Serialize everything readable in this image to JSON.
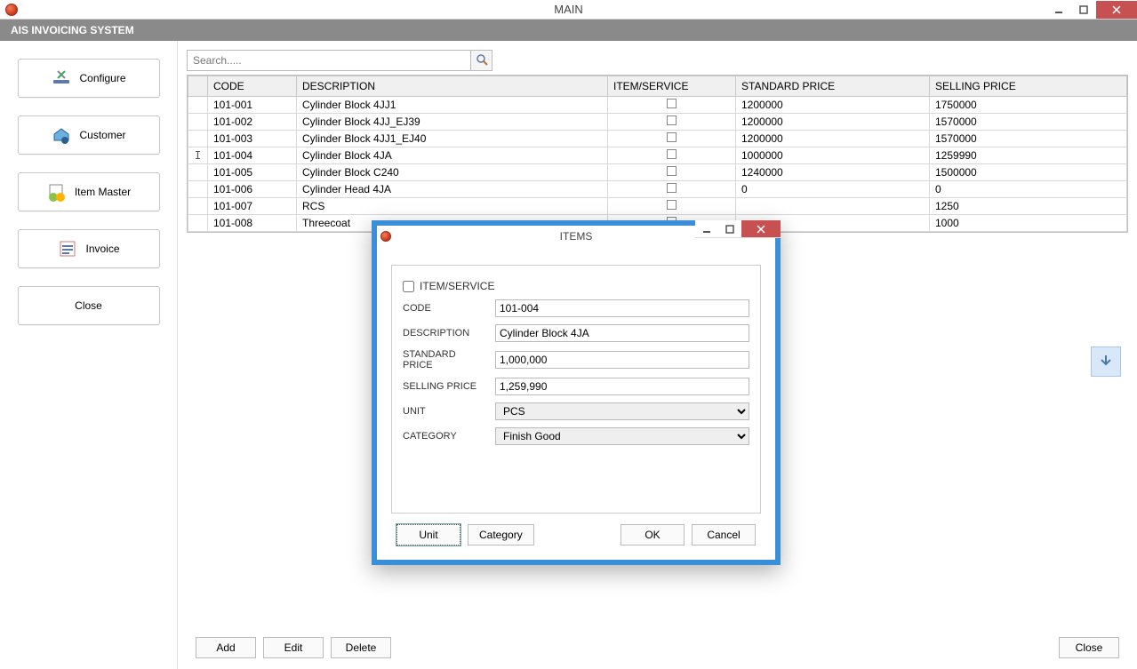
{
  "window": {
    "title": "MAIN"
  },
  "ribbon": {
    "title": "AIS INVOICING SYSTEM"
  },
  "sidebar": {
    "configure": "Configure",
    "customer": "Customer",
    "item_master": "Item Master",
    "invoice": "Invoice",
    "close": "Close"
  },
  "search": {
    "placeholder": "Search....."
  },
  "table": {
    "headers": {
      "code": "CODE",
      "description": "DESCRIPTION",
      "item_service": "ITEM/SERVICE",
      "standard_price": "STANDARD PRICE",
      "selling_price": "SELLING PRICE"
    },
    "rows": [
      {
        "indicator": "",
        "code": "101-001",
        "description": "Cylinder Block 4JJ1",
        "standard_price": "1200000",
        "selling_price": "1750000"
      },
      {
        "indicator": "",
        "code": "101-002",
        "description": "Cylinder Block 4JJ_EJ39",
        "standard_price": "1200000",
        "selling_price": "1570000"
      },
      {
        "indicator": "",
        "code": "101-003",
        "description": "Cylinder Block 4JJ1_EJ40",
        "standard_price": "1200000",
        "selling_price": "1570000"
      },
      {
        "indicator": "I",
        "code": "101-004",
        "description": "Cylinder Block 4JA",
        "standard_price": "1000000",
        "selling_price": "1259990"
      },
      {
        "indicator": "",
        "code": "101-005",
        "description": "Cylinder Block C240",
        "standard_price": "1240000",
        "selling_price": "1500000"
      },
      {
        "indicator": "",
        "code": "101-006",
        "description": "Cylinder Head 4JA",
        "standard_price": "0",
        "selling_price": "0"
      },
      {
        "indicator": "",
        "code": "101-007",
        "description": "RCS",
        "standard_price": "",
        "selling_price": "1250"
      },
      {
        "indicator": "",
        "code": "101-008",
        "description": "Threecoat",
        "standard_price": "",
        "selling_price": "1000"
      }
    ]
  },
  "bottom": {
    "add": "Add",
    "edit": "Edit",
    "delete": "Delete",
    "close": "Close"
  },
  "dialog": {
    "title": "ITEMS",
    "item_service_label": "ITEM/SERVICE",
    "code_label": "CODE",
    "code_value": "101-004",
    "description_label": "DESCRIPTION",
    "description_value": "Cylinder Block 4JA",
    "standard_price_label": "STANDARD PRICE",
    "standard_price_value": "1,000,000",
    "selling_price_label": "SELLING PRICE",
    "selling_price_value": "1,259,990",
    "unit_label": "UNIT",
    "unit_value": "PCS",
    "category_label": "CATEGORY",
    "category_value": "Finish Good",
    "btn_unit": "Unit",
    "btn_category": "Category",
    "btn_ok": "OK",
    "btn_cancel": "Cancel"
  }
}
